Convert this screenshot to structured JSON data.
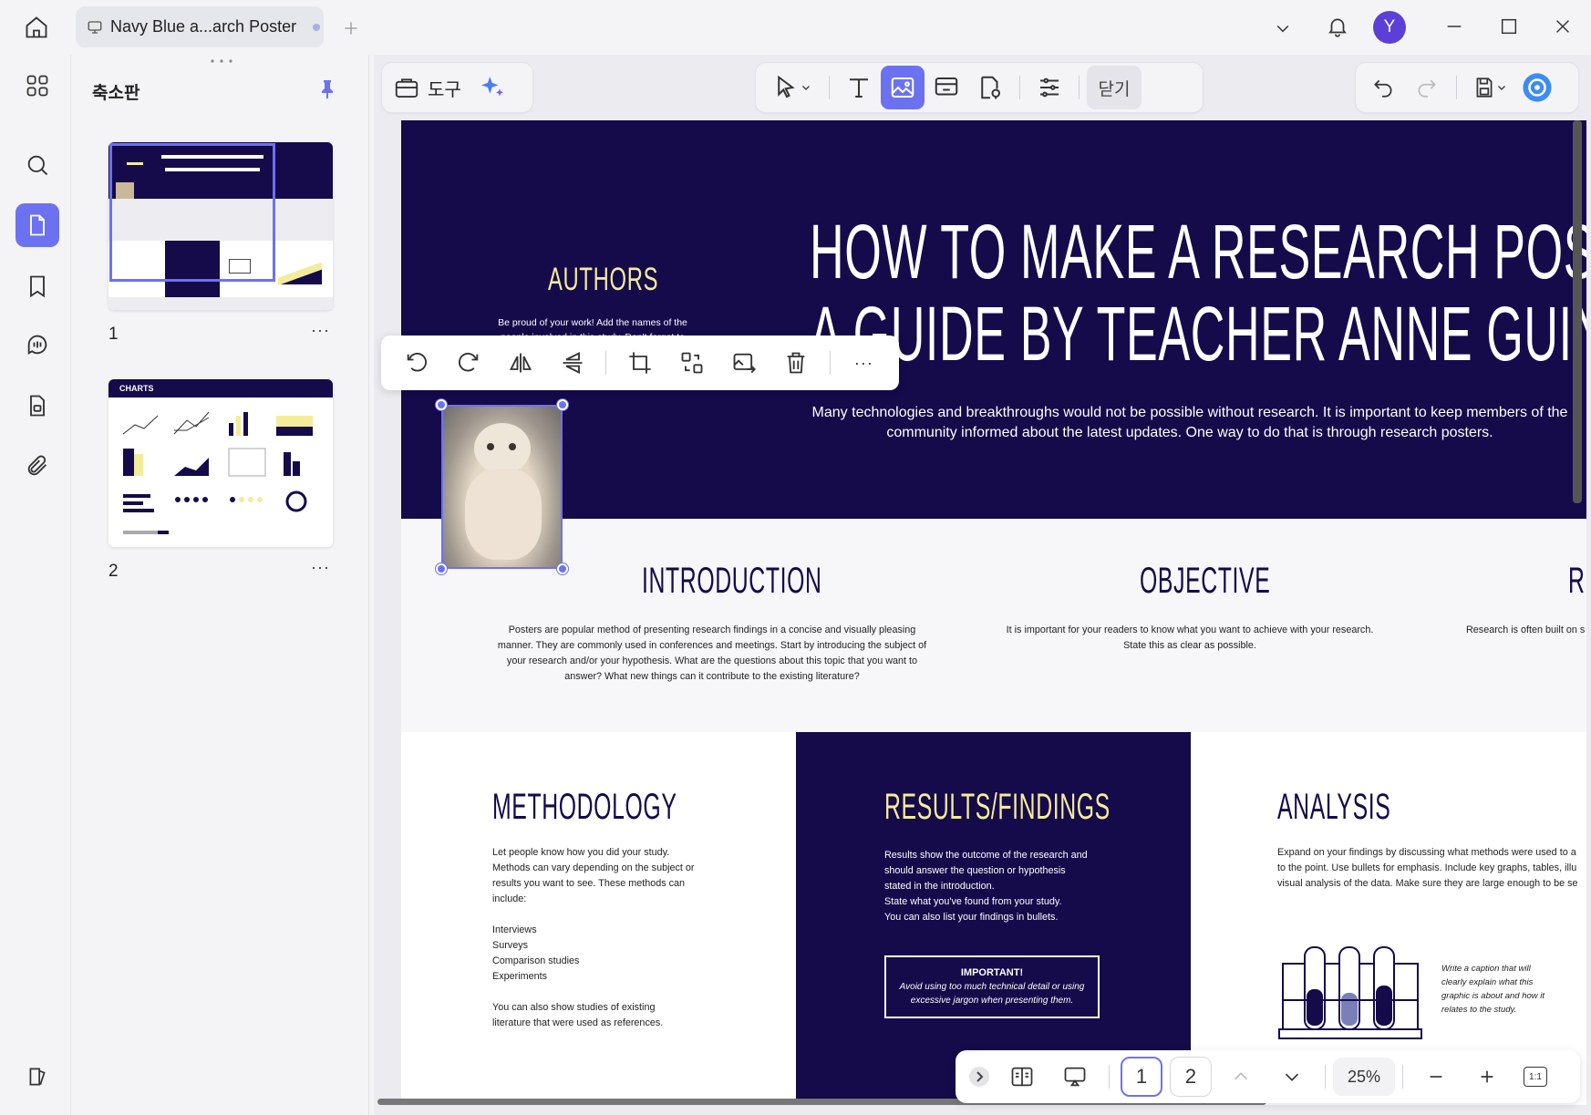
{
  "titlebar": {
    "tab_title": "Navy Blue a...arch Poster",
    "avatar_letter": "Y"
  },
  "panel": {
    "title": "축소판",
    "pages": [
      {
        "number": "1"
      },
      {
        "number": "2"
      }
    ],
    "thumb2_heading": "CHARTS"
  },
  "toolbar": {
    "tools_label": "도구",
    "close_label": "닫기"
  },
  "poster": {
    "title_line1": "HOW TO MAKE A RESEARCH POSTER",
    "title_line2": "A GUIDE BY TEACHER ANNE GUINTO",
    "authors_heading": "AUTHORS",
    "authors_text": "Be proud of your work! Add the names of the people involved in this study. Don't forget to",
    "hero_desc": "Many technologies and breakthroughs would not be possible without research. It is important to keep members of the community informed about the latest updates. One way to do that is through research posters.",
    "intro_heading": "INTRODUCTION",
    "intro_text": "Posters are popular method of presenting research findings in a concise and visually pleasing manner. They are commonly used in conferences and meetings. Start by introducing the subject of your research and/or your hypothesis. What are the questions about this topic that you want to answer? What new things can it contribute to the existing literature?",
    "objective_heading": "OBJECTIVE",
    "objective_text": "It is important for your readers to know what you want to achieve with your research. State this as clear as possible.",
    "related_heading": "R",
    "related_text": "Research is often built on s",
    "methodology_heading": "METHODOLOGY",
    "methodology_text": "Let people know how you did your study.\nMethods can vary depending on the subject or\nresults you want to see. These methods can\ninclude:\n\nInterviews\nSurveys\nComparison studies\nExperiments\n\nYou can also show studies of existing\nliterature that were used as references.",
    "results_heading": "RESULTS/FINDINGS",
    "results_text": "Results show the outcome of the research and\nshould answer the question or hypothesis\nstated in the introduction.\nState what you've found from your study.\nYou can also list your findings in bullets.",
    "important_title": "IMPORTANT!",
    "important_text": "Avoid using too much technical detail or using excessive jargon when presenting them.",
    "analysis_heading": "ANALYSIS",
    "analysis_text": "Expand on your findings by discussing what methods were used to a\nto the point. Use bullets for emphasis. Include key graphs, tables, illu\nvisual analysis of the data. Make sure they are large enough to be se",
    "caption_text": "Write a caption that will clearly explain what this graphic is about and how it relates to the study."
  },
  "bottombar": {
    "page1": "1",
    "page2": "2",
    "zoom": "25%",
    "fit_label": "1:1"
  },
  "colors": {
    "accent": "#6c72ef",
    "navy": "#150a4a",
    "yellow": "#f4ec9b"
  }
}
